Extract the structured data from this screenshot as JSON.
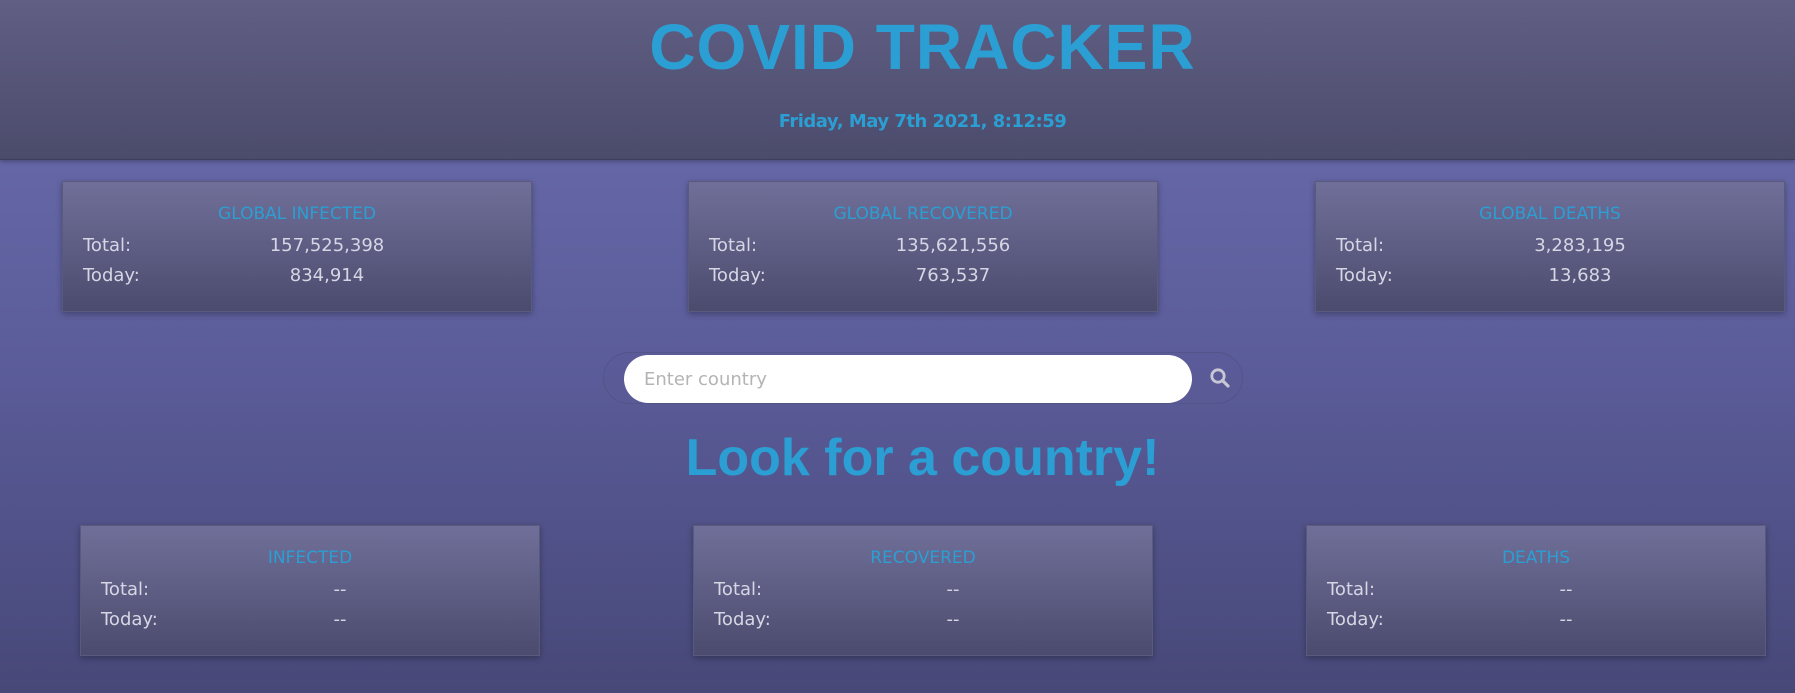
{
  "header": {
    "title": "COVID TRACKER",
    "datetime": "Friday, May 7th 2021, 8:12:59"
  },
  "global": [
    {
      "title": "GLOBAL INFECTED",
      "total_label": "Total:",
      "total": "157,525,398",
      "today_label": "Today:",
      "today": "834,914"
    },
    {
      "title": "GLOBAL RECOVERED",
      "total_label": "Total:",
      "total": "135,621,556",
      "today_label": "Today:",
      "today": "763,537"
    },
    {
      "title": "GLOBAL DEATHS",
      "total_label": "Total:",
      "total": "3,283,195",
      "today_label": "Today:",
      "today": "13,683"
    }
  ],
  "search": {
    "placeholder": "Enter country",
    "value": "",
    "button_icon": "search-icon"
  },
  "prompt": "Look for a country!",
  "country": [
    {
      "title": "INFECTED",
      "total_label": "Total:",
      "total": "--",
      "today_label": "Today:",
      "today": "--"
    },
    {
      "title": "RECOVERED",
      "total_label": "Total:",
      "total": "--",
      "today_label": "Today:",
      "today": "--"
    },
    {
      "title": "DEATHS",
      "total_label": "Total:",
      "total": "--",
      "today_label": "Today:",
      "today": "--"
    }
  ],
  "colors": {
    "accent": "#2b9fd3",
    "text": "#d6d6e4",
    "background": "#5a5b98"
  }
}
